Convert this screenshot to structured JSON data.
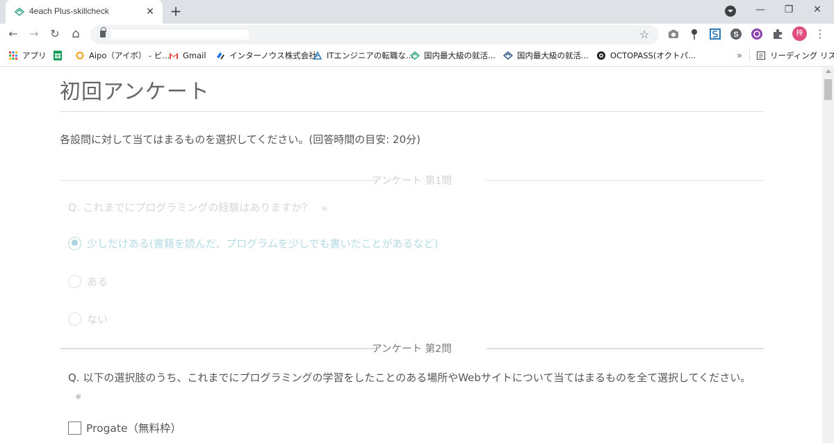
{
  "browser": {
    "tab_title": "4each Plus-skillcheck",
    "tab_close": "✕",
    "new_tab": "+",
    "window_controls": {
      "minimize": "—",
      "restore": "❐",
      "close": "✕"
    },
    "nav": {
      "back": "←",
      "forward": "→",
      "reload": "↻",
      "home": "⌂"
    },
    "url": "",
    "star": "☆",
    "extensions": [
      "camera-icon",
      "pin-icon",
      "s-box-icon",
      "s-circle-icon",
      "purple-extension-icon",
      "puzzle-icon",
      "avatar"
    ],
    "profile_initial": "梓",
    "menu": "⋮"
  },
  "bookmarks": {
    "items": [
      {
        "label": "アプリ",
        "icon": "apps-grid-icon"
      },
      {
        "label": "",
        "icon": "sheets-icon"
      },
      {
        "label": "Aipo（アイボ） - ビ...",
        "icon": "aipo-icon"
      },
      {
        "label": "Gmail",
        "icon": "gmail-icon"
      },
      {
        "label": "インターノウス株式会社",
        "icon": "internous-icon"
      },
      {
        "label": "ITエンジニアの転職な...",
        "icon": "it-engineer-icon"
      },
      {
        "label": "国内最大級の就活...",
        "icon": "shukatsu-icon"
      },
      {
        "label": "国内最大級の就活...",
        "icon": "shukatsu-icon"
      },
      {
        "label": "OCTOPASS(オクトパ...",
        "icon": "octopass-icon"
      }
    ],
    "overflow": "»",
    "reading_list": "リーディング リスト"
  },
  "page": {
    "title": "初回アンケート",
    "instruction": "各設問に対して当てはまるものを選択してください。(回答時間の目安: 20分)"
  },
  "questions": [
    {
      "heading": "アンケート 第1問",
      "text": "Q. これまでにプログラミングの経験はありますか？",
      "required_mark": "※",
      "options": [
        {
          "label": "少しだけある(書籍を読んだ、プログラムを少しでも書いたことがあるなど)",
          "selected": true
        },
        {
          "label": "ある",
          "selected": false
        },
        {
          "label": "ない",
          "selected": false
        }
      ]
    },
    {
      "heading": "アンケート 第2問",
      "text": "Q. 以下の選択肢のうち、これまでにプログラミングの学習をしたことのある場所やWebサイトについて当てはまるものを全て選択してください。",
      "required_mark": "※",
      "options": [
        {
          "label": "Progate（無料枠）",
          "selected": false
        }
      ]
    }
  ],
  "colors": {
    "heading_faded": "#d0d0d0",
    "heading_active": "#777777",
    "text_faded": "#d6d6d6",
    "text_active": "#555555",
    "selected_accent": "#a9d6e0"
  }
}
